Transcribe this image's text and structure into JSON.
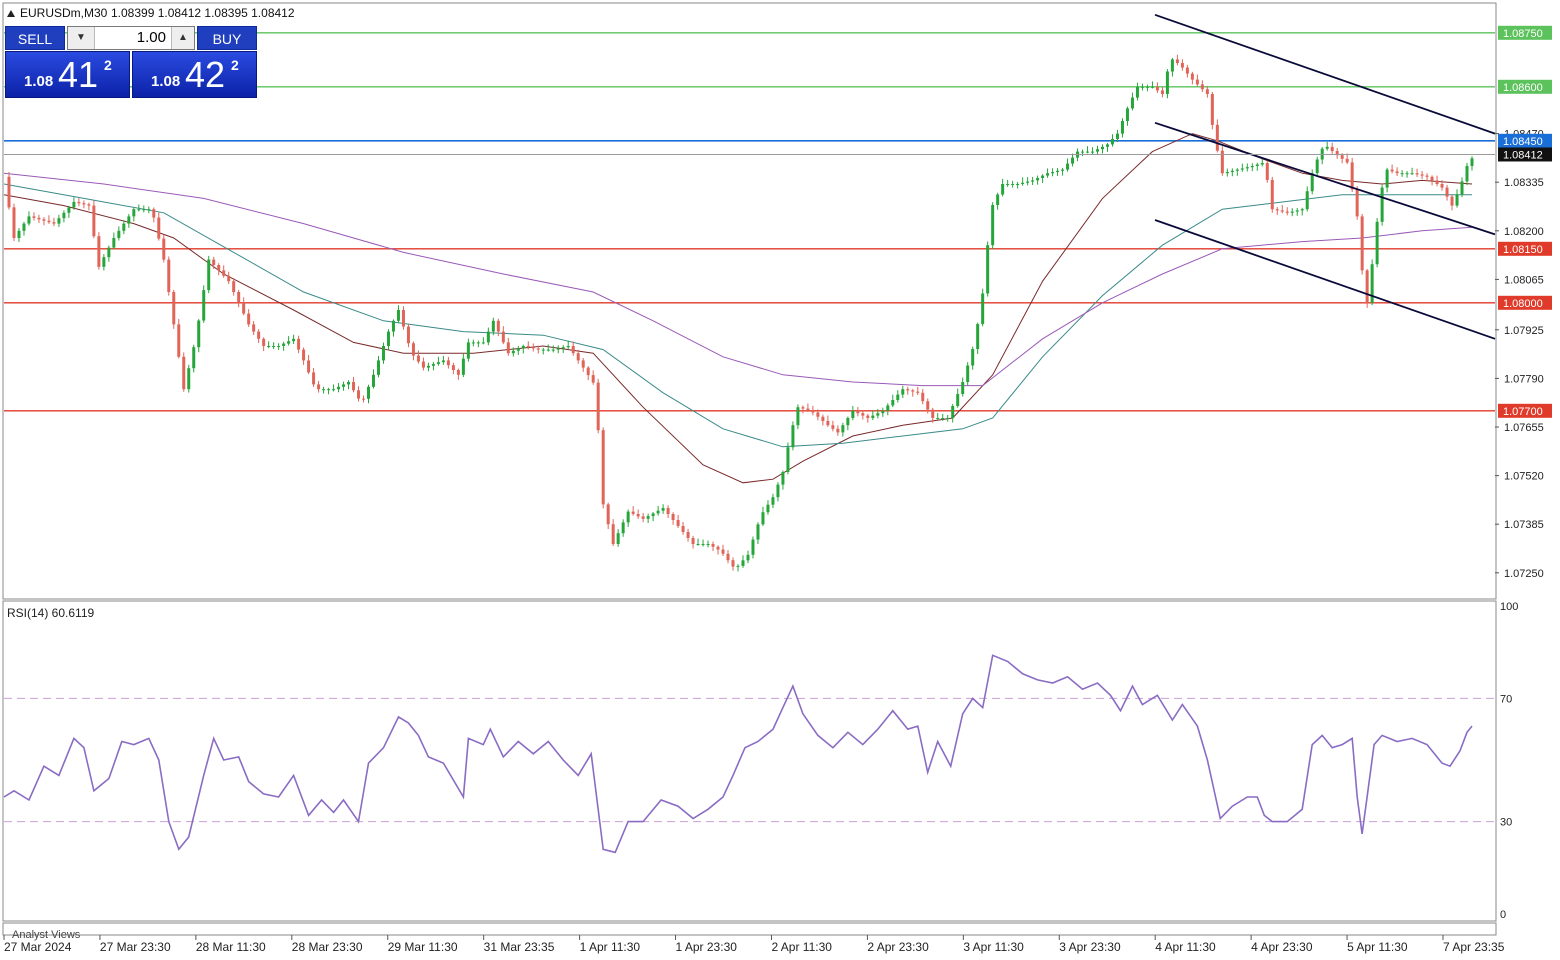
{
  "window": {
    "symbol_label": "EURUSDm,M30",
    "ohlc_label": "1.08399 1.08412 1.08395 1.08412"
  },
  "trade_panel": {
    "sell_label": "SELL",
    "buy_label": "BUY",
    "lot": "1.00",
    "sell_price": {
      "small": "1.08",
      "big": "41",
      "sup": "2"
    },
    "buy_price": {
      "small": "1.08",
      "big": "42",
      "sup": "2"
    }
  },
  "indicator": {
    "label": "RSI(14) 60.6119",
    "levels": [
      70,
      30
    ],
    "scale_labels": [
      "100",
      "70",
      "30",
      "0"
    ]
  },
  "bottom_label": "Analyst Views",
  "colors": {
    "up": "#26a63a",
    "down": "#e06458",
    "resistance": "#5cc25c",
    "support": "#e03a2a",
    "pivot": "#1a6ed8",
    "channel": "#0a0a3a",
    "rsi": "#8a6cc4",
    "ma_fast": "#7a2a2a",
    "ma_mid": "#3a8a8a",
    "ma_slow": "#9a5ab8"
  },
  "chart_data": {
    "type": "candlestick",
    "symbol": "EURUSDm",
    "timeframe": "M30",
    "ylim": [
      1.0718,
      1.0883
    ],
    "price_ticks": [
      "1.08470",
      "1.08335",
      "1.08200",
      "1.08065",
      "1.07925",
      "1.07790",
      "1.07655",
      "1.07520",
      "1.07385",
      "1.07250"
    ],
    "time_ticks": [
      "27 Mar 2024",
      "27 Mar 23:30",
      "28 Mar 11:30",
      "28 Mar 23:30",
      "29 Mar 11:30",
      "31 Mar 23:35",
      "1 Apr 11:30",
      "1 Apr 23:30",
      "2 Apr 11:30",
      "2 Apr 23:30",
      "3 Apr 11:30",
      "3 Apr 23:30",
      "4 Apr 11:30",
      "4 Apr 23:30",
      "5 Apr 11:30",
      "7 Apr 23:35"
    ],
    "current_price": "1.08412",
    "horizontal_levels": [
      {
        "price": 1.0875,
        "label": "1.08750",
        "kind": "resistance"
      },
      {
        "price": 1.086,
        "label": "1.08600",
        "kind": "resistance"
      },
      {
        "price": 1.0845,
        "label": "1.08450",
        "kind": "pivot"
      },
      {
        "price": 1.0815,
        "label": "1.08150",
        "kind": "support"
      },
      {
        "price": 1.08,
        "label": "1.08000",
        "kind": "support"
      },
      {
        "price": 1.077,
        "label": "1.07700",
        "kind": "support"
      }
    ],
    "price_path": [
      [
        0,
        1.0835
      ],
      [
        10,
        1.0818
      ],
      [
        25,
        1.0824
      ],
      [
        50,
        1.0822
      ],
      [
        70,
        1.0828
      ],
      [
        85,
        1.0827
      ],
      [
        95,
        1.081
      ],
      [
        110,
        1.0818
      ],
      [
        130,
        1.0826
      ],
      [
        148,
        1.0826
      ],
      [
        160,
        1.0812
      ],
      [
        170,
        1.0794
      ],
      [
        180,
        1.0776
      ],
      [
        192,
        1.079
      ],
      [
        205,
        1.0812
      ],
      [
        225,
        1.0806
      ],
      [
        245,
        1.0794
      ],
      [
        260,
        1.0788
      ],
      [
        275,
        1.0788
      ],
      [
        290,
        1.079
      ],
      [
        300,
        1.0784
      ],
      [
        312,
        1.0776
      ],
      [
        330,
        1.0776
      ],
      [
        345,
        1.0778
      ],
      [
        358,
        1.0772
      ],
      [
        370,
        1.078
      ],
      [
        385,
        1.0792
      ],
      [
        395,
        1.0798
      ],
      [
        408,
        1.0786
      ],
      [
        420,
        1.0782
      ],
      [
        440,
        1.0784
      ],
      [
        455,
        1.078
      ],
      [
        465,
        1.0789
      ],
      [
        480,
        1.0789
      ],
      [
        490,
        1.0795
      ],
      [
        505,
        1.0786
      ],
      [
        520,
        1.0788
      ],
      [
        535,
        1.0787
      ],
      [
        550,
        1.0787
      ],
      [
        565,
        1.0788
      ],
      [
        580,
        1.0782
      ],
      [
        592,
        1.0777
      ],
      [
        600,
        1.0744
      ],
      [
        610,
        1.0733
      ],
      [
        625,
        1.0742
      ],
      [
        640,
        1.074
      ],
      [
        660,
        1.0743
      ],
      [
        675,
        1.0738
      ],
      [
        690,
        1.0733
      ],
      [
        705,
        1.0733
      ],
      [
        718,
        1.0731
      ],
      [
        732,
        1.0726
      ],
      [
        745,
        1.073
      ],
      [
        758,
        1.0741
      ],
      [
        770,
        1.0746
      ],
      [
        780,
        1.0753
      ],
      [
        788,
        1.0764
      ],
      [
        795,
        1.0771
      ],
      [
        808,
        1.077
      ],
      [
        825,
        1.0766
      ],
      [
        835,
        1.0764
      ],
      [
        850,
        1.077
      ],
      [
        865,
        1.0768
      ],
      [
        880,
        1.077
      ],
      [
        900,
        1.0776
      ],
      [
        915,
        1.0775
      ],
      [
        930,
        1.0768
      ],
      [
        945,
        1.0768
      ],
      [
        960,
        1.0778
      ],
      [
        972,
        1.0789
      ],
      [
        982,
        1.0806
      ],
      [
        988,
        1.0826
      ],
      [
        1000,
        1.0833
      ],
      [
        1015,
        1.0833
      ],
      [
        1030,
        1.0834
      ],
      [
        1045,
        1.0836
      ],
      [
        1060,
        1.0837
      ],
      [
        1075,
        1.0842
      ],
      [
        1090,
        1.0842
      ],
      [
        1105,
        1.0844
      ],
      [
        1115,
        1.0847
      ],
      [
        1125,
        1.0854
      ],
      [
        1135,
        1.086
      ],
      [
        1150,
        1.086
      ],
      [
        1160,
        1.0858
      ],
      [
        1168,
        1.0868
      ],
      [
        1178,
        1.0866
      ],
      [
        1190,
        1.0862
      ],
      [
        1205,
        1.0858
      ],
      [
        1212,
        1.0846
      ],
      [
        1220,
        1.0836
      ],
      [
        1235,
        1.0837
      ],
      [
        1250,
        1.0838
      ],
      [
        1262,
        1.0839
      ],
      [
        1270,
        1.0826
      ],
      [
        1285,
        1.0825
      ],
      [
        1300,
        1.0826
      ],
      [
        1312,
        1.0838
      ],
      [
        1322,
        1.0844
      ],
      [
        1335,
        1.0841
      ],
      [
        1345,
        1.0839
      ],
      [
        1355,
        1.0824
      ],
      [
        1360,
        1.0809
      ],
      [
        1365,
        1.08
      ],
      [
        1372,
        1.0815
      ],
      [
        1378,
        1.083
      ],
      [
        1385,
        1.0837
      ],
      [
        1395,
        1.0836
      ],
      [
        1410,
        1.0836
      ],
      [
        1425,
        1.0835
      ],
      [
        1440,
        1.0832
      ],
      [
        1450,
        1.0827
      ],
      [
        1458,
        1.0832
      ],
      [
        1465,
        1.0838
      ],
      [
        1472,
        1.0841
      ]
    ],
    "moving_averages": [
      {
        "path": [
          [
            0,
            1.083
          ],
          [
            60,
            1.0827
          ],
          [
            130,
            1.0822
          ],
          [
            170,
            1.0818
          ],
          [
            220,
            1.0808
          ],
          [
            290,
            1.0798
          ],
          [
            350,
            1.0789
          ],
          [
            400,
            1.0786
          ],
          [
            470,
            1.0786
          ],
          [
            540,
            1.0788
          ],
          [
            590,
            1.0786
          ],
          [
            640,
            1.0771
          ],
          [
            700,
            1.0755
          ],
          [
            740,
            1.075
          ],
          [
            770,
            1.0751
          ],
          [
            800,
            1.0756
          ],
          [
            850,
            1.0763
          ],
          [
            900,
            1.0766
          ],
          [
            950,
            1.0768
          ],
          [
            990,
            1.078
          ],
          [
            1040,
            1.0806
          ],
          [
            1100,
            1.0829
          ],
          [
            1150,
            1.0842
          ],
          [
            1190,
            1.0847
          ],
          [
            1215,
            1.0845
          ],
          [
            1260,
            1.084
          ],
          [
            1300,
            1.0836
          ],
          [
            1340,
            1.0834
          ],
          [
            1380,
            1.0833
          ],
          [
            1420,
            1.0834
          ],
          [
            1470,
            1.0833
          ]
        ]
      },
      {
        "path": [
          [
            0,
            1.0833
          ],
          [
            80,
            1.0829
          ],
          [
            160,
            1.0825
          ],
          [
            230,
            1.0814
          ],
          [
            300,
            1.0803
          ],
          [
            380,
            1.0795
          ],
          [
            460,
            1.0792
          ],
          [
            540,
            1.0791
          ],
          [
            600,
            1.0787
          ],
          [
            660,
            1.0775
          ],
          [
            720,
            1.0765
          ],
          [
            780,
            1.076
          ],
          [
            840,
            1.0761
          ],
          [
            900,
            1.0763
          ],
          [
            960,
            1.0765
          ],
          [
            990,
            1.0768
          ],
          [
            1040,
            1.0785
          ],
          [
            1100,
            1.0802
          ],
          [
            1160,
            1.0816
          ],
          [
            1220,
            1.0826
          ],
          [
            1280,
            1.0828
          ],
          [
            1340,
            1.083
          ],
          [
            1400,
            1.083
          ],
          [
            1470,
            1.083
          ]
        ]
      },
      {
        "path": [
          [
            0,
            1.0836
          ],
          [
            100,
            1.0833
          ],
          [
            200,
            1.0829
          ],
          [
            300,
            1.0822
          ],
          [
            400,
            1.0814
          ],
          [
            500,
            1.0808
          ],
          [
            590,
            1.0803
          ],
          [
            650,
            1.0795
          ],
          [
            720,
            1.0785
          ],
          [
            780,
            1.078
          ],
          [
            850,
            1.0778
          ],
          [
            920,
            1.0777
          ],
          [
            980,
            1.0777
          ],
          [
            1040,
            1.079
          ],
          [
            1100,
            1.08
          ],
          [
            1160,
            1.0808
          ],
          [
            1220,
            1.0815
          ],
          [
            1300,
            1.0817
          ],
          [
            1360,
            1.0818
          ],
          [
            1420,
            1.082
          ],
          [
            1470,
            1.0821
          ]
        ]
      }
    ],
    "channel_lines": [
      {
        "from": [
          "4 Apr 11:30",
          1.088
        ],
        "to": [
          "7 Apr 23:35",
          1.0847
        ]
      },
      {
        "from": [
          "4 Apr 11:30",
          1.085
        ],
        "to": [
          "7 Apr 23:35",
          1.0819
        ]
      },
      {
        "from": [
          "4 Apr 11:30",
          1.0823
        ],
        "to": [
          "7 Apr 23:35",
          1.079
        ]
      }
    ],
    "rsi": {
      "name": "RSI(14)",
      "last_value": 60.6119,
      "ylim": [
        0,
        100
      ],
      "levels": [
        70,
        30
      ],
      "path": [
        [
          0,
          38
        ],
        [
          10,
          40
        ],
        [
          25,
          37
        ],
        [
          40,
          48
        ],
        [
          55,
          45
        ],
        [
          70,
          57
        ],
        [
          80,
          54
        ],
        [
          90,
          40
        ],
        [
          105,
          44
        ],
        [
          118,
          56
        ],
        [
          130,
          55
        ],
        [
          145,
          57
        ],
        [
          155,
          50
        ],
        [
          165,
          30
        ],
        [
          175,
          21
        ],
        [
          185,
          25
        ],
        [
          200,
          45
        ],
        [
          210,
          57
        ],
        [
          220,
          50
        ],
        [
          235,
          51
        ],
        [
          245,
          43
        ],
        [
          260,
          39
        ],
        [
          275,
          38
        ],
        [
          290,
          45
        ],
        [
          305,
          32
        ],
        [
          318,
          37
        ],
        [
          330,
          33
        ],
        [
          340,
          37
        ],
        [
          355,
          30
        ],
        [
          365,
          49
        ],
        [
          380,
          54
        ],
        [
          395,
          64
        ],
        [
          405,
          62
        ],
        [
          415,
          58
        ],
        [
          425,
          51
        ],
        [
          440,
          49
        ],
        [
          460,
          38
        ],
        [
          465,
          57
        ],
        [
          480,
          55
        ],
        [
          487,
          60
        ],
        [
          500,
          51
        ],
        [
          515,
          56
        ],
        [
          530,
          52
        ],
        [
          545,
          56
        ],
        [
          560,
          50
        ],
        [
          575,
          45
        ],
        [
          588,
          52
        ],
        [
          600,
          21
        ],
        [
          612,
          20
        ],
        [
          625,
          30
        ],
        [
          640,
          30
        ],
        [
          658,
          37
        ],
        [
          675,
          35
        ],
        [
          690,
          31
        ],
        [
          705,
          34
        ],
        [
          720,
          38
        ],
        [
          730,
          45
        ],
        [
          742,
          54
        ],
        [
          755,
          56
        ],
        [
          770,
          60
        ],
        [
          780,
          67
        ],
        [
          790,
          74
        ],
        [
          800,
          65
        ],
        [
          815,
          58
        ],
        [
          830,
          54
        ],
        [
          845,
          59
        ],
        [
          860,
          55
        ],
        [
          875,
          60
        ],
        [
          890,
          66
        ],
        [
          905,
          60
        ],
        [
          915,
          61
        ],
        [
          925,
          46
        ],
        [
          935,
          56
        ],
        [
          948,
          48
        ],
        [
          960,
          65
        ],
        [
          970,
          70
        ],
        [
          980,
          67
        ],
        [
          990,
          84
        ],
        [
          1005,
          82
        ],
        [
          1020,
          78
        ],
        [
          1035,
          76
        ],
        [
          1050,
          75
        ],
        [
          1065,
          77
        ],
        [
          1080,
          73
        ],
        [
          1095,
          75
        ],
        [
          1108,
          71
        ],
        [
          1118,
          66
        ],
        [
          1130,
          74
        ],
        [
          1140,
          68
        ],
        [
          1155,
          71
        ],
        [
          1170,
          63
        ],
        [
          1180,
          68
        ],
        [
          1195,
          61
        ],
        [
          1205,
          50
        ],
        [
          1218,
          31
        ],
        [
          1230,
          35
        ],
        [
          1245,
          38
        ],
        [
          1255,
          38
        ],
        [
          1262,
          32
        ],
        [
          1270,
          30
        ],
        [
          1285,
          30
        ],
        [
          1300,
          34
        ],
        [
          1310,
          55
        ],
        [
          1320,
          58
        ],
        [
          1330,
          54
        ],
        [
          1340,
          55
        ],
        [
          1350,
          57
        ],
        [
          1355,
          38
        ],
        [
          1360,
          26
        ],
        [
          1365,
          38
        ],
        [
          1372,
          55
        ],
        [
          1380,
          58
        ],
        [
          1395,
          56
        ],
        [
          1410,
          57
        ],
        [
          1425,
          55
        ],
        [
          1440,
          49
        ],
        [
          1448,
          48
        ],
        [
          1458,
          53
        ],
        [
          1465,
          59
        ],
        [
          1470,
          61
        ]
      ]
    }
  }
}
